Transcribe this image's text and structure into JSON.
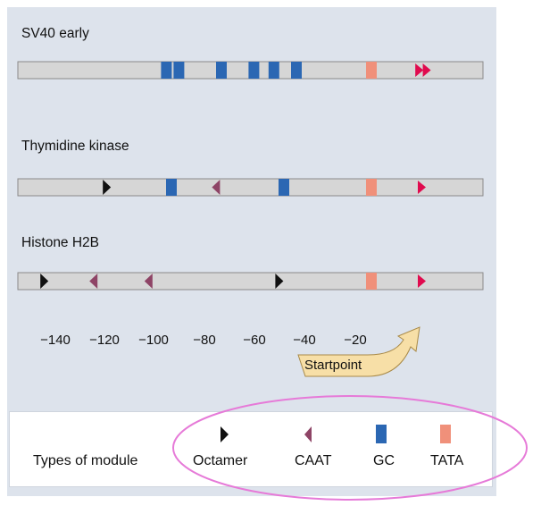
{
  "colors": {
    "panel": "#dde3ec",
    "bar": "#d6d6d6",
    "octamer": "#111111",
    "caat": "#8e4466",
    "gc": "#2b67b3",
    "tata": "#f0907a",
    "startpoint_arrow": "#f7dfa7",
    "highlight_ellipse": "#e67ad8",
    "start_marker": "#e00b4e"
  },
  "promoters": [
    {
      "name": "SV40 early",
      "modules": [
        {
          "type": "GC",
          "position": -102
        },
        {
          "type": "GC",
          "position": -97
        },
        {
          "type": "GC",
          "position": -80
        },
        {
          "type": "GC",
          "position": -67
        },
        {
          "type": "GC",
          "position": -59
        },
        {
          "type": "GC",
          "position": -50
        },
        {
          "type": "TATA",
          "position": -20
        },
        {
          "type": "start",
          "position": -1
        },
        {
          "type": "start",
          "position": 2
        }
      ]
    },
    {
      "name": "Thymidine kinase",
      "modules": [
        {
          "type": "Octamer",
          "position": -126
        },
        {
          "type": "GC",
          "position": -100
        },
        {
          "type": "CAAT",
          "position": -82
        },
        {
          "type": "GC",
          "position": -55
        },
        {
          "type": "TATA",
          "position": -20
        },
        {
          "type": "start",
          "position": 0
        }
      ]
    },
    {
      "name": "Histone H2B",
      "modules": [
        {
          "type": "Octamer",
          "position": -151
        },
        {
          "type": "CAAT",
          "position": -131
        },
        {
          "type": "CAAT",
          "position": -109
        },
        {
          "type": "Octamer",
          "position": -57
        },
        {
          "type": "TATA",
          "position": -20
        },
        {
          "type": "start",
          "position": 0
        }
      ]
    }
  ],
  "axis": {
    "ticks": [
      "−140",
      "−120",
      "−100",
      "−80",
      "−60",
      "−40",
      "−20"
    ],
    "tick_values": [
      -140,
      -120,
      -100,
      -80,
      -60,
      -40,
      -20
    ],
    "range": [
      -152,
      27
    ]
  },
  "startpoint": {
    "label": "Startpoint"
  },
  "legend": {
    "title": "Types of module",
    "items": [
      {
        "label": "Octamer",
        "type": "Octamer",
        "icon": "octamer-triangle-icon"
      },
      {
        "label": "CAAT",
        "type": "CAAT",
        "icon": "caat-triangle-icon"
      },
      {
        "label": "GC",
        "type": "GC",
        "icon": "gc-box-icon"
      },
      {
        "label": "TATA",
        "type": "TATA",
        "icon": "tata-box-icon"
      }
    ]
  }
}
